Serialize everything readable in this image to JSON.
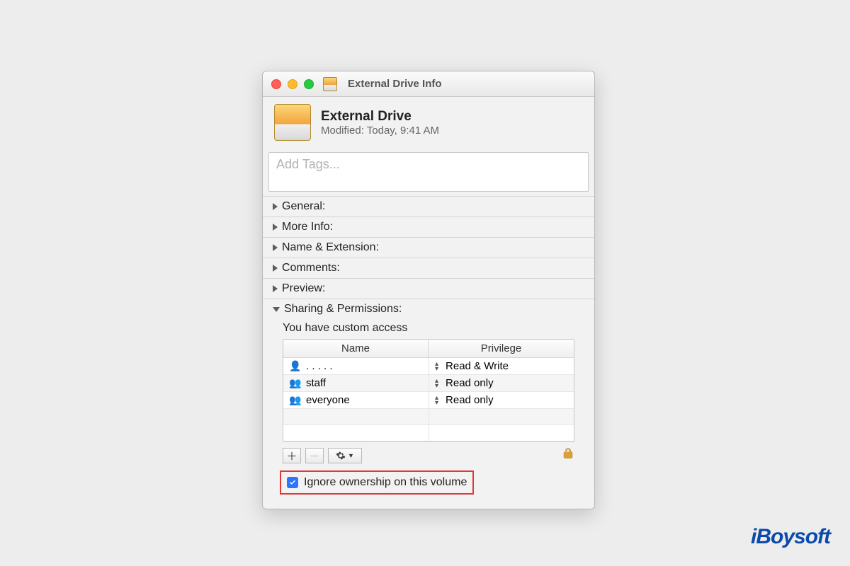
{
  "titlebar": {
    "title": "External Drive Info"
  },
  "header": {
    "name": "External Drive",
    "modified": "Modified:  Today, 9:41 AM"
  },
  "tags": {
    "placeholder": "Add Tags..."
  },
  "sections": {
    "general": "General:",
    "more_info": "More Info:",
    "name_ext": "Name & Extension:",
    "comments": "Comments:",
    "preview": "Preview:",
    "sharing": "Sharing & Permissions:"
  },
  "sharing": {
    "access_text": "You have custom access",
    "columns": {
      "name": "Name",
      "privilege": "Privilege"
    },
    "rows": [
      {
        "icon": "single",
        "name": ".   .  .   . .",
        "privilege": "Read & Write"
      },
      {
        "icon": "group",
        "name": "staff",
        "privilege": "Read only"
      },
      {
        "icon": "group",
        "name": "everyone",
        "privilege": "Read only"
      }
    ]
  },
  "toolbar": {
    "add": "＋",
    "remove": "－",
    "gear": "✱"
  },
  "ignore": {
    "label": "Ignore ownership on this volume",
    "checked": true
  },
  "watermark": "iBoysoft"
}
